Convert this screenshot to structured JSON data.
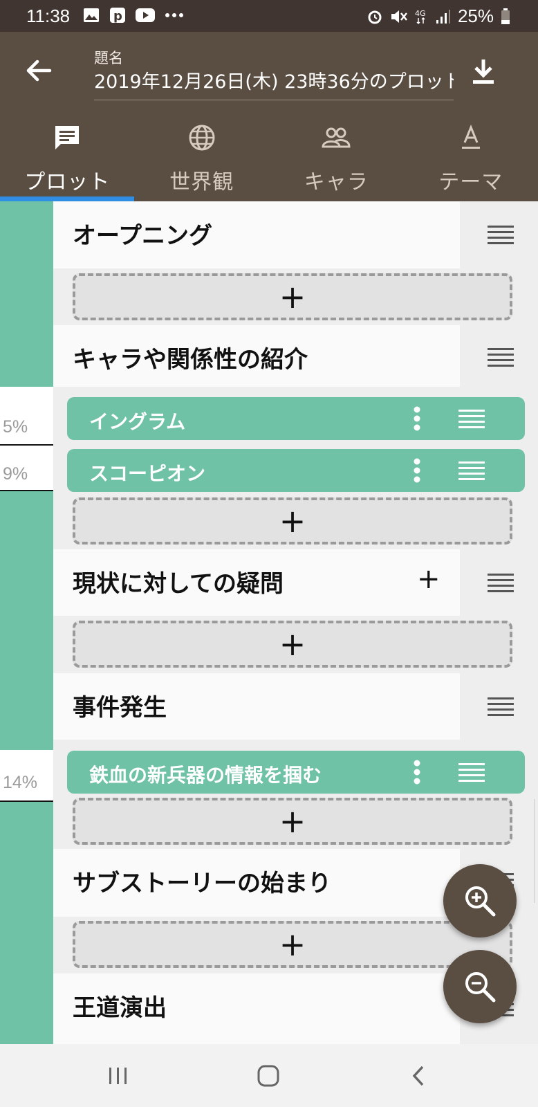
{
  "status_bar": {
    "time": "11:38",
    "left_icons": [
      "image-icon",
      "p-app-icon",
      "youtube-icon",
      "more-icon"
    ],
    "right_icons": [
      "alarm-icon",
      "mute-icon",
      "4g-icon",
      "signal-icon"
    ],
    "battery": "25%"
  },
  "app_bar": {
    "title_label": "題名",
    "title_value": "2019年12月26日(木) 23時36分のプロット",
    "back_icon": "arrow-left-icon",
    "download_icon": "download-icon"
  },
  "tabs": [
    {
      "label": "プロット",
      "icon": "chat-icon",
      "active": true
    },
    {
      "label": "世界観",
      "icon": "globe-icon",
      "active": false
    },
    {
      "label": "キャラ",
      "icon": "people-icon",
      "active": false
    },
    {
      "label": "テーマ",
      "icon": "text-a-icon",
      "active": false
    }
  ],
  "percent_markers": [
    "5%",
    "9%",
    "14%"
  ],
  "sections": [
    {
      "title": "オープニング"
    },
    {
      "title": "キャラや関係性の紹介",
      "cards": [
        "イングラム",
        "スコーピオン"
      ]
    },
    {
      "title": "現状に対しての疑問"
    },
    {
      "title": "事件発生",
      "cards": [
        "鉄血の新兵器の情報を掴む"
      ]
    },
    {
      "title": "サブストーリーの始まり"
    },
    {
      "title": "王道演出"
    }
  ],
  "add_button_symbol": "+",
  "fabs": {
    "zoom_in": "zoom-in-icon",
    "zoom_out": "zoom-out-icon"
  },
  "nav_bar": {
    "recents": "recents-icon",
    "home": "home-icon",
    "back": "back-icon"
  },
  "colors": {
    "app_bar": "#5a4d42",
    "status_bar": "#403530",
    "accent_green": "#6fc2a6",
    "tab_indicator": "#2f8ee4"
  }
}
